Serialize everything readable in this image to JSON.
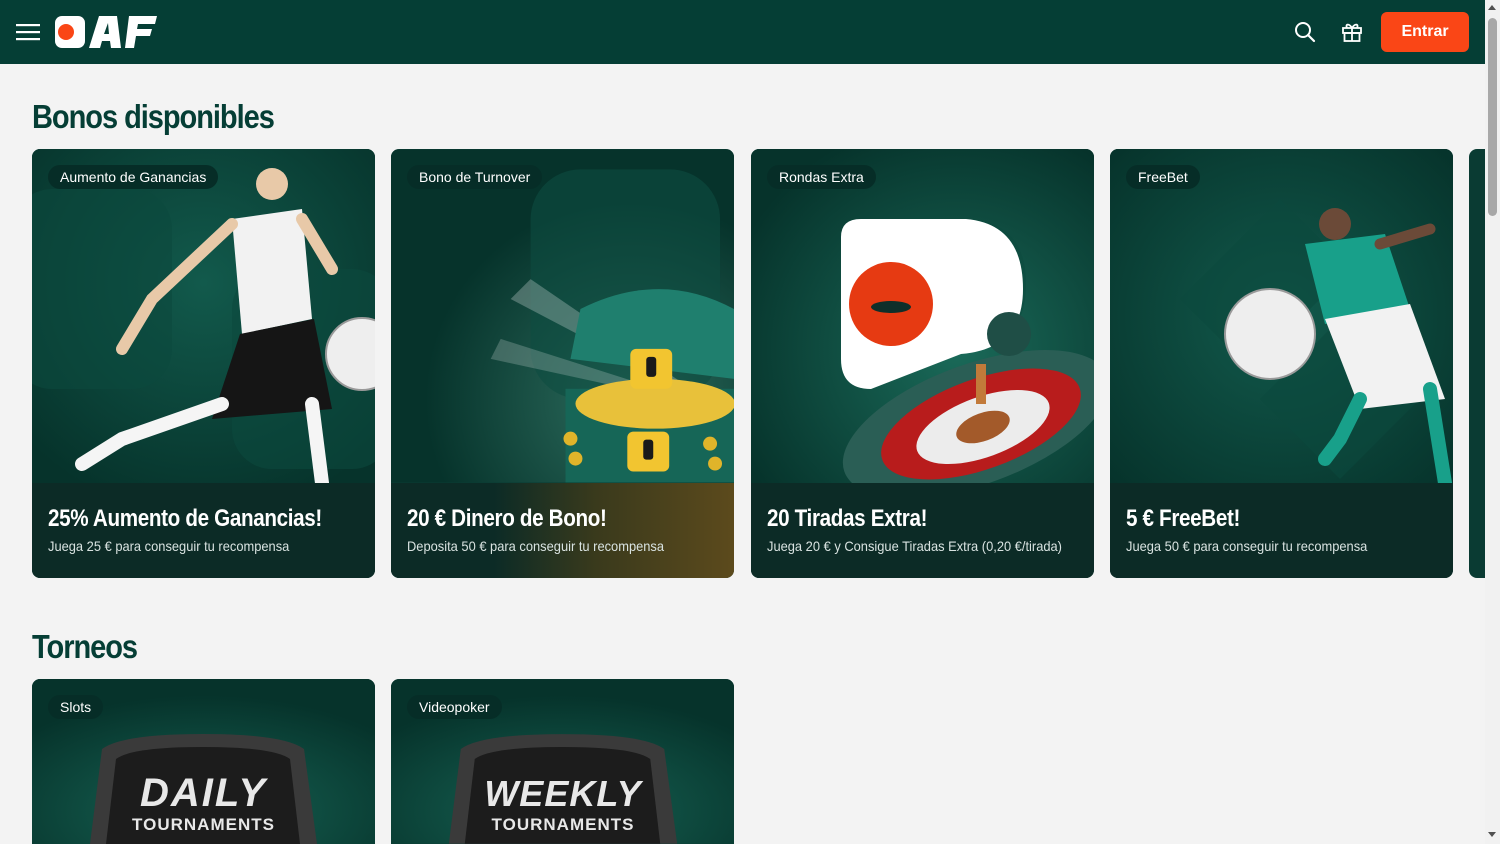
{
  "header": {
    "logo": "PAF",
    "login_label": "Entrar",
    "colors": {
      "background": "#053e35",
      "accent": "#fa4616"
    },
    "icons": [
      "menu-icon",
      "search-icon",
      "gift-icon"
    ]
  },
  "bonus_section": {
    "title": "Bonos disponibles",
    "cards": [
      {
        "badge": "Aumento de Ganancias",
        "title": "25% Aumento de Ganancias!",
        "subtitle": "Juega 25 € para conseguir tu recompensa"
      },
      {
        "badge": "Bono de Turnover",
        "title": "20 € Dinero de Bono!",
        "subtitle": "Deposita 50 € para conseguir tu recompensa"
      },
      {
        "badge": "Rondas Extra",
        "title": "20 Tiradas Extra!",
        "subtitle": "Juega 20 € y Consigue Tiradas Extra (0,20 €/tirada)"
      },
      {
        "badge": "FreeBet",
        "title": "5 € FreeBet!",
        "subtitle": "Juega 50 € para conseguir tu recompensa"
      }
    ]
  },
  "tournament_section": {
    "title": "Torneos",
    "cards": [
      {
        "badge": "Slots",
        "art_line1": "DAILY",
        "art_line2": "TOURNAMENTS"
      },
      {
        "badge": "Videopoker",
        "art_line1": "WEEKLY",
        "art_line2": "TOURNAMENTS"
      }
    ]
  }
}
